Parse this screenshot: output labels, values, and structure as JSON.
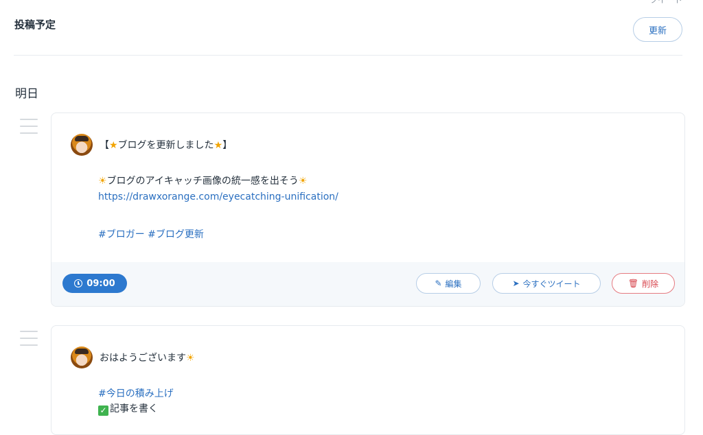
{
  "header": {
    "title": "投稿予定",
    "refresh_label": "更新",
    "top_cut_text": "ツイート"
  },
  "section": {
    "title": "明日"
  },
  "posts": [
    {
      "title_open": "【",
      "title_star": "★",
      "title_text": "ブログを更新しました",
      "title_star2": "★",
      "title_close": "】",
      "line2_sun": "☀",
      "line2_text": "ブログのアイキャッチ画像の統一感を出そう",
      "line2_sun2": "☀",
      "link": "https://drawxorange.com/eyecatching-unification/",
      "hashtags": "#ブロガー #ブログ更新",
      "time": "09:00",
      "edit_label": "編集",
      "tweet_now_label": "今すぐツイート",
      "delete_label": "削除"
    },
    {
      "greeting": "おはようございます",
      "greeting_sun": "☀",
      "hashtag": "#今日の積み上げ",
      "check_mark": "✓",
      "task": "記事を書く"
    }
  ],
  "icons": {
    "clock": "clock-icon",
    "edit": "edit-icon",
    "send": "send-icon",
    "trash": "trash-icon",
    "drag": "drag-handle-icon"
  },
  "colors": {
    "accent": "#2d79cf",
    "link": "#2a6fc0",
    "danger": "#d7444c",
    "footer_bg": "#f5f8fb"
  }
}
